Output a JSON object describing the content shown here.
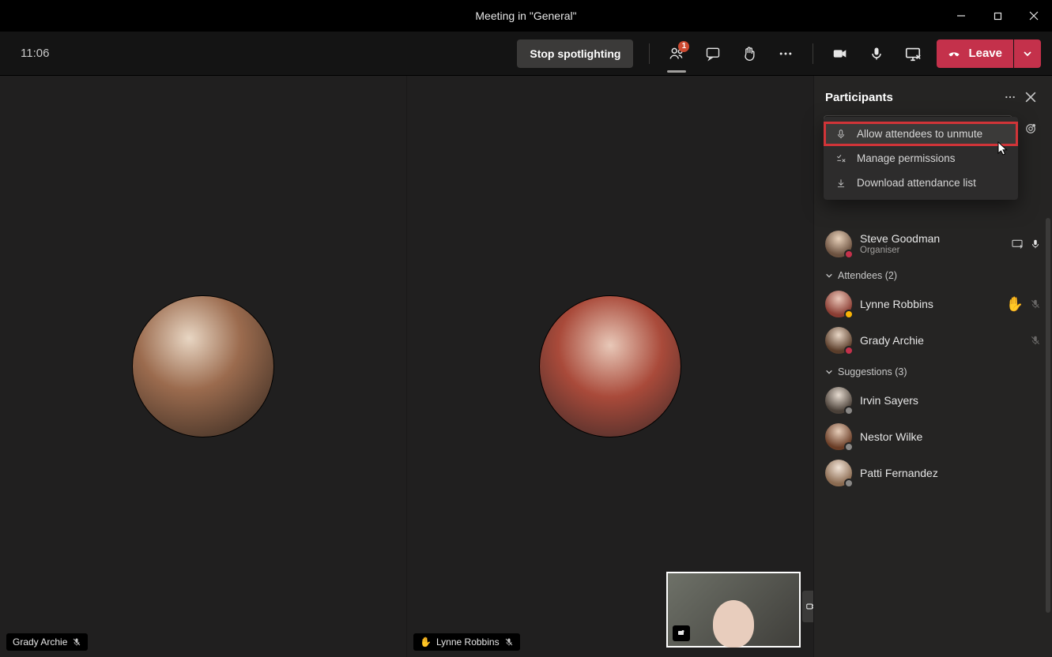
{
  "window": {
    "title": "Meeting in \"General\""
  },
  "toolbar": {
    "clock": "11:06",
    "stop_spotlight": "Stop spotlighting",
    "people_badge": "1",
    "leave": "Leave"
  },
  "stage": {
    "tiles": [
      {
        "name": "Grady Archie",
        "has_hand": false,
        "mic_muted": true
      },
      {
        "name": "Lynne Robbins",
        "has_hand": true,
        "mic_muted": true
      }
    ]
  },
  "panel": {
    "title": "Participants",
    "menu": {
      "allow_unmute": "Allow attendees to unmute",
      "manage_permissions": "Manage permissions",
      "download_attendance": "Download attendance list"
    },
    "presenter_row": {
      "name": "Steve Goodman",
      "role": "Organiser"
    },
    "attendees_label": "Attendees (2)",
    "attendees": [
      {
        "name": "Lynne Robbins",
        "hand": true,
        "muted": true
      },
      {
        "name": "Grady Archie",
        "hand": false,
        "muted": true
      }
    ],
    "suggestions_label": "Suggestions (3)",
    "suggestions": [
      {
        "name": "Irvin Sayers"
      },
      {
        "name": "Nestor Wilke"
      },
      {
        "name": "Patti Fernandez"
      }
    ]
  }
}
